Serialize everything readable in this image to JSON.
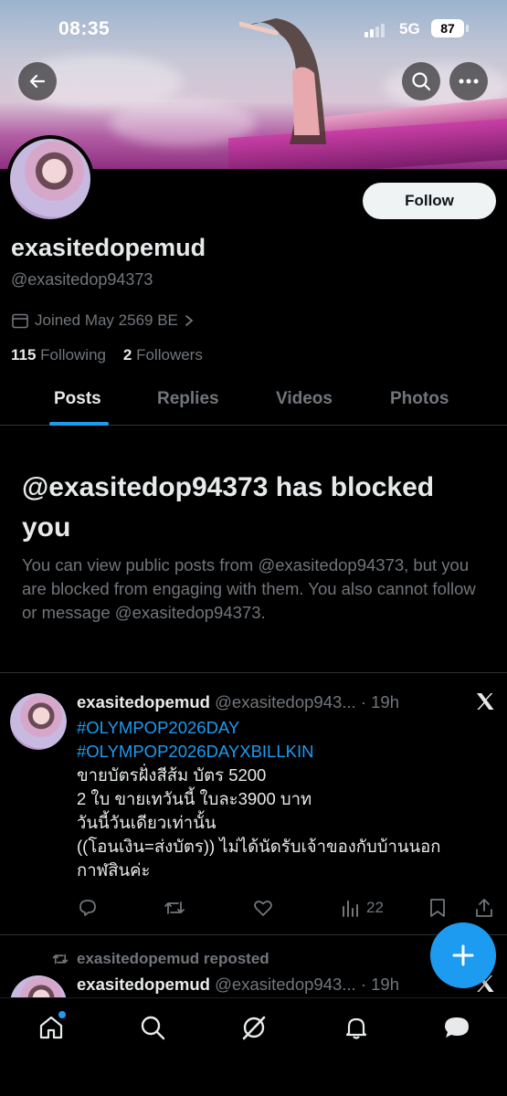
{
  "status_bar": {
    "time": "08:35",
    "network": "5G",
    "battery": "87"
  },
  "profile": {
    "display_name": "exasitedopemud",
    "handle": "@exasitedop94373",
    "joined": "Joined May 2569 BE",
    "following_count": "115",
    "following_label": "Following",
    "followers_count": "2",
    "followers_label": "Followers",
    "follow_label": "Follow"
  },
  "tabs": [
    "Posts",
    "Replies",
    "Videos",
    "Photos"
  ],
  "blocked": {
    "title": "@exasitedop94373 has blocked you",
    "description": "You can view public posts from @exasitedop94373, but you are blocked from engaging with them. You also cannot follow or message @exasitedop94373."
  },
  "tweet": {
    "name": "exasitedopemud",
    "handle": "@exasitedop943...",
    "time": "· 19h",
    "hashtags": [
      "#OLYMPOP2026DAY",
      "#OLYMPOP2026DAYXBILLKIN"
    ],
    "lines": [
      "ขายบัตรฝั่งสีส้ม บัตร 5200",
      "2 ใบ ขายเทวันนี้ ใบละ3900 บาท",
      "วันนี้วันเดียวเท่านั้น",
      "((โอนเงิน=ส่งบัตร)) ไม่ได้นัดรับเจ้าของกับบ้านนอก",
      "กาฬสินค่ะ"
    ],
    "views": "22"
  },
  "repost": {
    "label": "exasitedopemud reposted",
    "name": "exasitedopemud",
    "handle": "@exasitedop943...",
    "time": "· 19h"
  },
  "colors": {
    "accent": "#1d9bf0",
    "background": "#000000",
    "muted": "#71767b",
    "text": "#e7e9ea"
  }
}
